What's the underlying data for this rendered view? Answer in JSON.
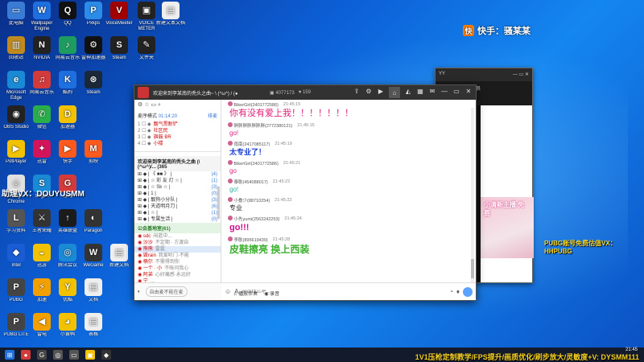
{
  "desktop": {
    "icons": [
      {
        "label": "此电脑",
        "color": "#3a7bd5",
        "glyph": "▭"
      },
      {
        "label": "Wallpaper Engine",
        "color": "#1e6fe0",
        "glyph": "W"
      },
      {
        "label": "QQ",
        "color": "#111111",
        "glyph": "Q"
      },
      {
        "label": "Pxkps",
        "color": "#2b8be6",
        "glyph": "P"
      },
      {
        "label": "VoiceMeeter",
        "color": "#a00000",
        "glyph": "V"
      },
      {
        "label": "VOICE METER",
        "color": "#222222",
        "glyph": "▣"
      },
      {
        "label": "新建文本文档",
        "color": "#eeeeee",
        "glyph": "▤"
      },
      {
        "label": "回收站",
        "color": "#c08a1e",
        "glyph": "▥"
      },
      {
        "label": "NVIDIA",
        "color": "#222222",
        "glyph": "N"
      },
      {
        "label": "网易云音乐",
        "color": "#1e9c60",
        "glyph": "♪"
      },
      {
        "label": "雷神加速器",
        "color": "#111111",
        "glyph": "⚙"
      },
      {
        "label": "Steam",
        "color": "#222222",
        "glyph": "S"
      },
      {
        "label": "文件夹",
        "color": "#222222",
        "glyph": "✎"
      },
      {
        "label": "Microsoft Edge",
        "color": "#1a8ad4",
        "glyph": "e"
      },
      {
        "label": "网易云音乐",
        "color": "#d33a3a",
        "glyph": "♫"
      },
      {
        "label": "酷狗",
        "color": "#1e6fe0",
        "glyph": "K"
      },
      {
        "label": "Steam",
        "color": "#1b2838",
        "glyph": "⊛"
      },
      {
        "label": "OBS Studio",
        "color": "#222222",
        "glyph": "◉"
      },
      {
        "label": "微信",
        "color": "#2aae4a",
        "glyph": "✆"
      },
      {
        "label": "加速器",
        "color": "#f2c200",
        "glyph": "D"
      },
      {
        "label": "PotPlayer",
        "color": "#f2c200",
        "glyph": "▶"
      },
      {
        "label": "迅雷",
        "color": "#d4145a",
        "glyph": "✦"
      },
      {
        "label": "快手",
        "color": "#ff5a1e",
        "glyph": "▶"
      },
      {
        "label": "剪映",
        "color": "#ff5a1e",
        "glyph": "M"
      },
      {
        "label": "Google Chrome",
        "color": "#e0e0e0",
        "glyph": "◎"
      },
      {
        "label": "Sogou",
        "color": "#1a8ad4",
        "glyph": "S"
      },
      {
        "label": "游戏",
        "color": "#d33a3a",
        "glyph": "G"
      },
      {
        "label": "学习资料",
        "color": "#555555",
        "glyph": "L"
      },
      {
        "label": "王者荣耀",
        "color": "#333333",
        "glyph": "⚔"
      },
      {
        "label": "英雄联盟",
        "color": "#1b1b1b",
        "glyph": "↑"
      },
      {
        "label": "Paragon",
        "color": "#333333",
        "glyph": "◐"
      },
      {
        "label": "Intel",
        "color": "#1a5cd4",
        "glyph": "◆"
      },
      {
        "label": "迅游",
        "color": "#f2c200",
        "glyph": "◒"
      },
      {
        "label": "腾讯会议",
        "color": "#1a8ad4",
        "glyph": "◎"
      },
      {
        "label": "WeGame",
        "color": "#333333",
        "glyph": "W"
      },
      {
        "label": "新建文档",
        "color": "#eeeeee",
        "glyph": "▤"
      },
      {
        "label": "PUBG",
        "color": "#444444",
        "glyph": "P"
      },
      {
        "label": "加速",
        "color": "#f2a000",
        "glyph": "⚡"
      },
      {
        "label": "优酷",
        "color": "#f2c200",
        "glyph": "Y"
      },
      {
        "label": "文档",
        "color": "#eeeeee",
        "glyph": "▤"
      },
      {
        "label": "PUBG LITE",
        "color": "#444444",
        "glyph": "P"
      },
      {
        "label": "雷电",
        "color": "#f2a000",
        "glyph": "◀"
      },
      {
        "label": "小黄鸭",
        "color": "#f2c200",
        "glyph": "◕"
      },
      {
        "label": "表格",
        "color": "#eeeeee",
        "glyph": "▤"
      }
    ],
    "watermark_left": "助理VX：DOUYUSMM",
    "watermark_right": "PUBG账号免费估值VX：HHPUBG",
    "kuaishou_label": "快手：骚某某"
  },
  "bg_window": {
    "title": "YY",
    "ad_text": "小清新主播 免费",
    "subtitle": "求帮 · 人 · 子 · 会员"
  },
  "main_window": {
    "title": "欢迎来到李某南的秃头之曲~ \\ (^ω^) / (●",
    "online": "4077173",
    "fans": "159",
    "left": {
      "tools": "⚙ ☆ ▭ ⌕",
      "mode_label": "麦序模式",
      "mode_time": "01:14:20",
      "mode_link": "排麦",
      "top_channels": [
        {
          "prefix": "☐ ◆",
          "name": "靓气贯耐铲"
        },
        {
          "prefix": "☐ ◆",
          "name": "社区民"
        },
        {
          "prefix": "☐ ◆",
          "name": "旗鼓 BR"
        },
        {
          "prefix": "☐ ◆",
          "name": "小楼"
        }
      ],
      "room_header": "欢迎来到李某南的秃头之曲 (\\(^ω^)/...",
      "room_count": "(365",
      "channels": [
        {
          "name": "| 《 ■■ 》 |",
          "count": "(4)"
        },
        {
          "name": "| ☆ 彩 友 灯 ☆ |",
          "count": "(1)"
        },
        {
          "name": "| ☆ Sk ☆ |",
          "count": "(3)"
        },
        {
          "name": "| 1 |",
          "count": "(0)"
        },
        {
          "name": "| 靓狗小分队 |",
          "count": "(3)"
        },
        {
          "name": "| 天道明月刀 |",
          "count": "(6)"
        },
        {
          "name": "| ☆ |",
          "count": "(1)"
        },
        {
          "name": "| 专属生活 |",
          "count": "(0)"
        }
      ],
      "group_label": "公会基地室",
      "group_count": "(61)",
      "members": [
        {
          "name": "sdc",
          "tag": "闲逛中..."
        },
        {
          "name": "沙沙",
          "tag": "不定期 · 方渡自"
        },
        {
          "name": "熊熊",
          "tag": "雷霆"
        },
        {
          "name": "毁rain",
          "tag": "我爱听门·不能"
        },
        {
          "name": "楠尔",
          "tag": "不需得到你"
        },
        {
          "name": "一个 · 小",
          "tag": "不帐问我心"
        },
        {
          "name": "阿弟",
          "tag": "心好痛感·永远好"
        },
        {
          "name": "宁",
          "tag": "..."
        }
      ]
    },
    "messages": [
      {
        "user": "BikerGirl(2401772586)",
        "time": "21:45:15",
        "text": "你有没有爱上我！！！！！！！",
        "color": "#e0207a",
        "size": "11px",
        "bold": false
      },
      {
        "user": "胖胖胖胖胖胖胖(2772380121)",
        "time": "21:45:15",
        "text": "go!",
        "color": "#e0207a",
        "size": "8px",
        "bold": false
      },
      {
        "user": "雨南(2417085117)",
        "time": "21:45:19",
        "text": "太专业了！",
        "color": "#1a3ed4",
        "size": "9px",
        "bold": true
      },
      {
        "user": "BikerGirl(2401772586)",
        "time": "21:45:21",
        "text": "go",
        "color": "#e0207a",
        "size": "8px",
        "bold": false
      },
      {
        "user": "泰耿(454088017)",
        "time": "21:45:22",
        "text": "go!",
        "color": "#2ab0a0",
        "size": "8px",
        "bold": false
      },
      {
        "user": "小叠少(88710254)",
        "time": "21:45:22",
        "text": "专业",
        "color": "#222222",
        "size": "8px",
        "bold": false
      },
      {
        "user": "小先yumi(2563242253)",
        "time": "21:45:24",
        "text": "go!!!",
        "color": "#d0108a",
        "size": "11px",
        "bold": true
      },
      {
        "user": "李耿(895619439)",
        "time": "21:45:28",
        "text": "皮鞋擦亮 换上西装",
        "color": "#3cb030",
        "size": "12px",
        "bold": true
      }
    ],
    "input_placeholder": "说点什么吧...",
    "bottom": {
      "mic": "◐",
      "mode": "自由麦不能在麦",
      "play": "播放伴奏",
      "record": "录音"
    }
  },
  "taskbar": {
    "icons": [
      {
        "name": "start-icon",
        "glyph": "⊞",
        "color": "#1e6fe0"
      },
      {
        "name": "netease-icon",
        "glyph": "●",
        "color": "#d33a3a"
      },
      {
        "name": "chrome-icon",
        "glyph": "G",
        "color": "#444444"
      },
      {
        "name": "chrome2-icon",
        "glyph": "◎",
        "color": "#555555"
      },
      {
        "name": "display-icon",
        "glyph": "▭",
        "color": "#555555"
      },
      {
        "name": "yy-icon",
        "glyph": "▣",
        "color": "#f2c200"
      },
      {
        "name": "game-icon",
        "glyph": "◆",
        "color": "#333333"
      }
    ],
    "clock_time": "21:45",
    "clock_date": "",
    "marquee": "1V1压枪定制教学/FPS提升/画质优化/刷步放大/灵敏度+V: DYSMM111"
  }
}
